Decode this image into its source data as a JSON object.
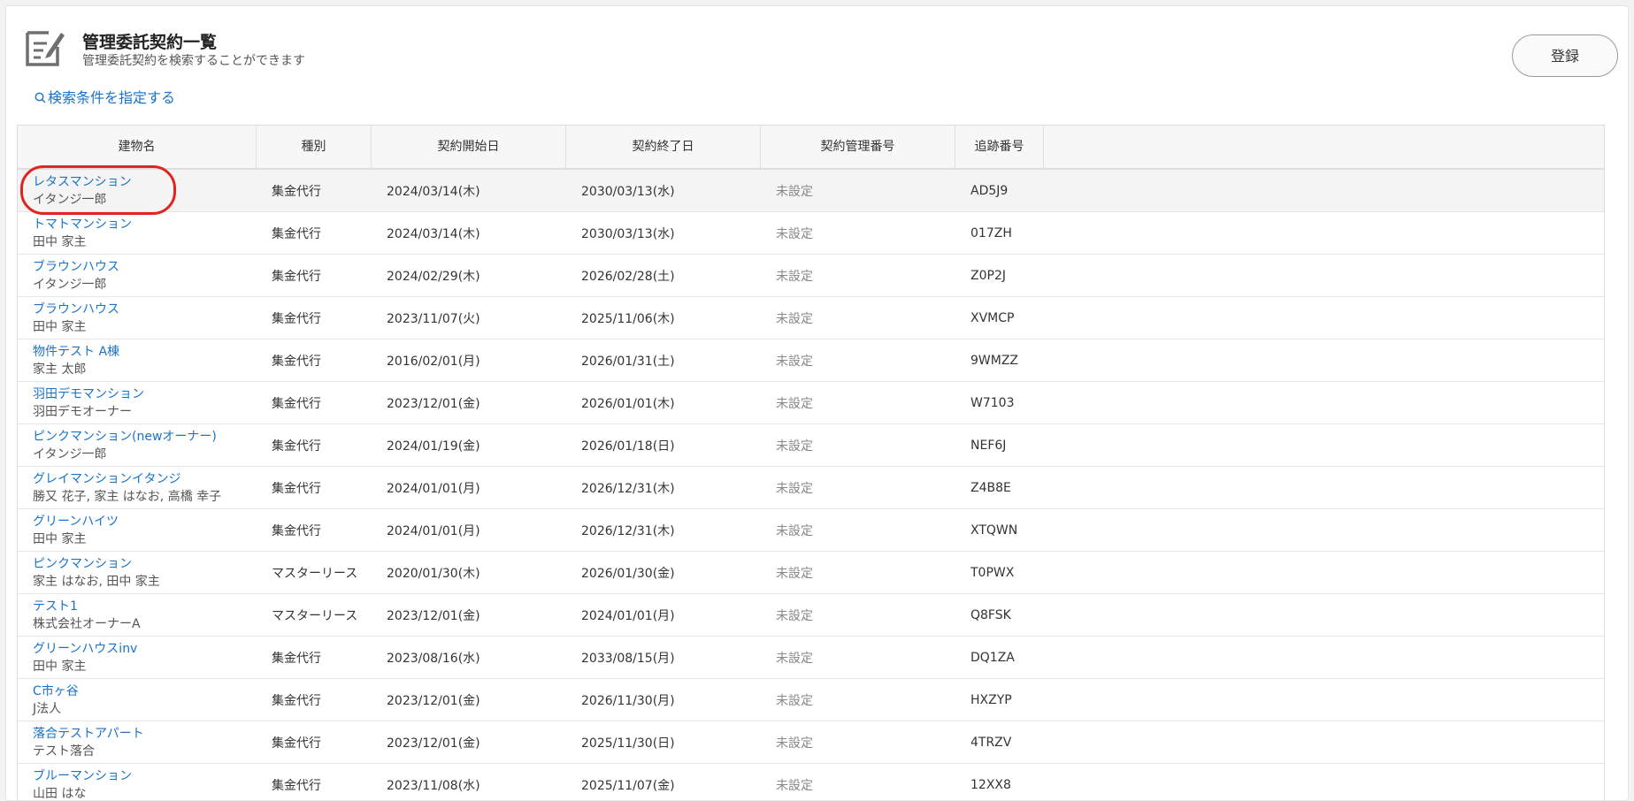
{
  "header": {
    "title": "管理委託契約一覧",
    "subtitle": "管理委託契約を検索することができます",
    "register_label": "登録"
  },
  "search": {
    "label": "検索条件を指定する"
  },
  "table": {
    "columns": [
      "建物名",
      "種別",
      "契約開始日",
      "契約終了日",
      "契約管理番号",
      "追跡番号"
    ],
    "rows": [
      {
        "building": "レタスマンション",
        "owner": "イタンジ一郎",
        "type": "集金代行",
        "start": "2024/03/14(木)",
        "end": "2030/03/13(水)",
        "mgmt_no": "未設定",
        "tracking": "AD5J9"
      },
      {
        "building": "トマトマンション",
        "owner": "田中 家主",
        "type": "集金代行",
        "start": "2024/03/14(木)",
        "end": "2030/03/13(水)",
        "mgmt_no": "未設定",
        "tracking": "017ZH"
      },
      {
        "building": "ブラウンハウス",
        "owner": "イタンジ一郎",
        "type": "集金代行",
        "start": "2024/02/29(木)",
        "end": "2026/02/28(土)",
        "mgmt_no": "未設定",
        "tracking": "Z0P2J"
      },
      {
        "building": "ブラウンハウス",
        "owner": "田中 家主",
        "type": "集金代行",
        "start": "2023/11/07(火)",
        "end": "2025/11/06(木)",
        "mgmt_no": "未設定",
        "tracking": "XVMCP"
      },
      {
        "building": "物件テスト A棟",
        "owner": "家主 太郎",
        "type": "集金代行",
        "start": "2016/02/01(月)",
        "end": "2026/01/31(土)",
        "mgmt_no": "未設定",
        "tracking": "9WMZZ"
      },
      {
        "building": "羽田デモマンション",
        "owner": "羽田デモオーナー",
        "type": "集金代行",
        "start": "2023/12/01(金)",
        "end": "2026/01/01(木)",
        "mgmt_no": "未設定",
        "tracking": "W7103"
      },
      {
        "building": "ピンクマンション(newオーナー)",
        "owner": "イタンジ一郎",
        "type": "集金代行",
        "start": "2024/01/19(金)",
        "end": "2026/01/18(日)",
        "mgmt_no": "未設定",
        "tracking": "NEF6J"
      },
      {
        "building": "グレイマンションイタンジ",
        "owner": "勝又 花子, 家主 はなお, 高橋 幸子",
        "type": "集金代行",
        "start": "2024/01/01(月)",
        "end": "2026/12/31(木)",
        "mgmt_no": "未設定",
        "tracking": "Z4B8E"
      },
      {
        "building": "グリーンハイツ",
        "owner": "田中 家主",
        "type": "集金代行",
        "start": "2024/01/01(月)",
        "end": "2026/12/31(木)",
        "mgmt_no": "未設定",
        "tracking": "XTQWN"
      },
      {
        "building": "ピンクマンション",
        "owner": "家主 はなお, 田中 家主",
        "type": "マスターリース",
        "start": "2020/01/30(木)",
        "end": "2026/01/30(金)",
        "mgmt_no": "未設定",
        "tracking": "T0PWX"
      },
      {
        "building": "テスト1",
        "owner": "株式会社オーナーA",
        "type": "マスターリース",
        "start": "2023/12/01(金)",
        "end": "2024/01/01(月)",
        "mgmt_no": "未設定",
        "tracking": "Q8FSK"
      },
      {
        "building": "グリーンハウスinv",
        "owner": "田中 家主",
        "type": "集金代行",
        "start": "2023/08/16(水)",
        "end": "2033/08/15(月)",
        "mgmt_no": "未設定",
        "tracking": "DQ1ZA"
      },
      {
        "building": "C市ヶ谷",
        "owner": "J法人",
        "type": "集金代行",
        "start": "2023/12/01(金)",
        "end": "2026/11/30(月)",
        "mgmt_no": "未設定",
        "tracking": "HXZYP"
      },
      {
        "building": "落合テストアパート",
        "owner": "テスト落合",
        "type": "集金代行",
        "start": "2023/12/01(金)",
        "end": "2025/11/30(日)",
        "mgmt_no": "未設定",
        "tracking": "4TRZV"
      },
      {
        "building": "ブルーマンション",
        "owner": "山田 はな",
        "type": "集金代行",
        "start": "2023/11/08(水)",
        "end": "2025/11/07(金)",
        "mgmt_no": "未設定",
        "tracking": "12XX8"
      }
    ]
  },
  "colors": {
    "link": "#1a73c8",
    "highlight": "#e0241f"
  },
  "icons": {
    "page": "edit-document-icon",
    "search": "search-icon"
  }
}
